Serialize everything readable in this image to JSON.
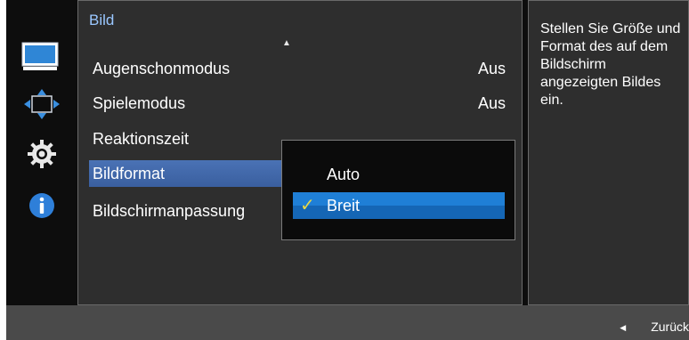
{
  "menu": {
    "title": "Bild",
    "items": [
      {
        "label": "Augenschonmodus",
        "value": "Aus"
      },
      {
        "label": "Spielemodus",
        "value": "Aus"
      },
      {
        "label": "Reaktionszeit",
        "value": ""
      },
      {
        "label": "Bildformat",
        "value": ""
      },
      {
        "label": "Bildschirmanpassung",
        "value": ""
      }
    ],
    "selected_index": 3
  },
  "dropdown": {
    "options": [
      {
        "label": "Auto",
        "checked": false
      },
      {
        "label": "Breit",
        "checked": true
      }
    ]
  },
  "help": {
    "text": "Stellen Sie Größe und Format des auf dem Bildschirm angezeigten Bildes ein."
  },
  "bottom": {
    "back_label": "Zurück"
  },
  "sidebar": {
    "icons": [
      "monitor-icon",
      "move-arrows-icon",
      "gear-icon",
      "info-icon"
    ]
  },
  "colors": {
    "title": "#9ac7ff",
    "selected_item": "#4a72b5",
    "dropdown_selected": "#1f7fd6",
    "checkmark": "#e5d84a",
    "info_icon": "#2e7fd9"
  }
}
